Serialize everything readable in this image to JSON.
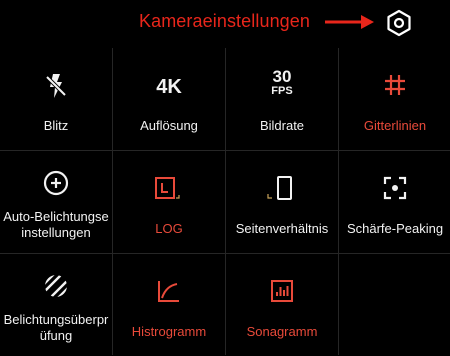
{
  "annotation": {
    "text": "Kameraeinstellungen",
    "color": "#e8261b"
  },
  "tiles": [
    {
      "label": "Blitz",
      "icon": "flash-off-icon",
      "active": false
    },
    {
      "label": "Auflösung",
      "icon": "resolution-4k-icon",
      "icon_text": "4K",
      "active": false
    },
    {
      "label": "Bildrate",
      "icon": "fps-30-icon",
      "icon_text": "30",
      "icon_subtext": "FPS",
      "active": false
    },
    {
      "label": "Gitterlinien",
      "icon": "grid-lines-icon",
      "active": true
    },
    {
      "label": "Auto-Belichtungseinstellungen",
      "icon": "auto-exposure-icon",
      "active": false
    },
    {
      "label": "LOG",
      "icon": "log-icon",
      "active": true
    },
    {
      "label": "Seitenverhältnis",
      "icon": "aspect-ratio-icon",
      "active": false
    },
    {
      "label": "Schärfe-Peaking",
      "icon": "focus-peaking-icon",
      "active": false
    },
    {
      "label": "Belichtungsüberprüfung",
      "icon": "zebra-stripes-icon",
      "active": false
    },
    {
      "label": "Histrogramm",
      "icon": "histogram-icon",
      "active": true
    },
    {
      "label": "Sonagramm",
      "icon": "sonagram-icon",
      "active": true
    }
  ],
  "colors": {
    "active": "#e84a3a",
    "inactive": "#f2f2f2",
    "annotation": "#e8261b",
    "background": "#000000"
  }
}
